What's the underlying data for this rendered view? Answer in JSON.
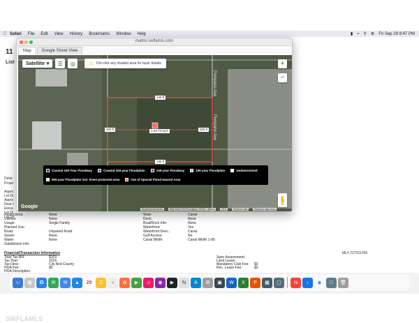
{
  "menubar": {
    "app": "Safari",
    "items": [
      "File",
      "Edit",
      "View",
      "History",
      "Bookmarks",
      "Window",
      "Help"
    ],
    "clock": "Fri Sep 29  8:47 PM"
  },
  "listing": {
    "title": "11",
    "list_label": "List",
    "side_labels": [
      "Detai",
      "Prope",
      "Appro",
      "Lot Di",
      "Appro",
      "Rear I",
      "Eleva",
      "Lot Di",
      "Lot De"
    ],
    "details_left": [
      {
        "k": "Restrictions:",
        "v": "None"
      },
      {
        "k": "Utilities:",
        "v": "None"
      },
      {
        "k": "Usage:",
        "v": "Single Family"
      },
      {
        "k": "Planned Use:",
        "v": ""
      },
      {
        "k": "Road:",
        "v": "Unpaved Road"
      },
      {
        "k": "Sewer:",
        "v": "None"
      },
      {
        "k": "Water:",
        "v": "None"
      },
      {
        "k": "Subdivision Info:",
        "v": ""
      }
    ],
    "details_right": [
      {
        "k": "View:",
        "v": "Canal"
      },
      {
        "k": "Dock:",
        "v": "None"
      },
      {
        "k": "Boat/Dock Info:",
        "v": "None"
      },
      {
        "k": "Waterfront:",
        "v": "Yes"
      },
      {
        "k": "Waterfront Desc.:",
        "v": "Canal"
      },
      {
        "k": "Gulf Access:",
        "v": "No"
      },
      {
        "k": "Canal Width:",
        "v": "Canal Width 1-80"
      }
    ],
    "mls_number": "ML# 217031266",
    "financial_heading": "Financial/Transaction Information",
    "financial_left": [
      {
        "k": "Total Tax Bill:",
        "v": "$169"
      },
      {
        "k": "Tax Year:",
        "v": "2016"
      },
      {
        "k": "Tax Desc:",
        "v": "City And County"
      },
      {
        "k": "HOA Fee:",
        "v": "$0"
      },
      {
        "k": "HOA Description:",
        "v": ""
      }
    ],
    "financial_right": [
      {
        "k": "Spec Assessment:",
        "v": ""
      },
      {
        "k": "Land Lease:",
        "v": ""
      },
      {
        "k": "Mandatory Club Fee:",
        "v": "$0"
      },
      {
        "k": "Rec. Lease Fee:",
        "v": "$0"
      }
    ]
  },
  "popup": {
    "url": "matrix.swflamls.com",
    "tabs": [
      "Map",
      "Google Street View"
    ],
    "map_type": "Satellite",
    "hint": "Ctrl-click any shaded area for layer details.",
    "street_name": "Pompano Ave",
    "lot_label": "1,23.73 sq ft",
    "dims": {
      "top": "140 ft",
      "left": "100 ft",
      "right": "100 ft",
      "bottom": "140 ft"
    },
    "legend": [
      {
        "label": "Coastal 100-Year Floodway",
        "color": "#1a237e"
      },
      {
        "label": "Coastal 100-year Floodplain",
        "color": "#3f51b5"
      },
      {
        "label": "100-year Floodway",
        "color": "#7b1fa2"
      },
      {
        "label": "100-year Floodplain",
        "color": "#b39ddb"
      },
      {
        "label": "Undetermined",
        "color": "#ffffff"
      },
      {
        "label": "500-year Floodplain incl. levee protected area",
        "color": "#fff176"
      },
      {
        "label": "Out of Special Flood Hazard Area",
        "color": "#ff7043"
      }
    ],
    "footer": [
      "Keyboard shortcuts",
      "Map Data ©2023 Imagery ©2023 , Airbus",
      "20 ft",
      "Terms of Use",
      "Report a map error"
    ],
    "google": "Google"
  },
  "dock": {
    "calendar_day": "29",
    "colors": [
      "#3a7bd5",
      "#e5e5e5",
      "#2f80ed",
      "#34a853",
      "#4285f4",
      "#1e88e5",
      "#2ecc71",
      "#e53935",
      "#fbc02d",
      "#8e24aa",
      "#ff7043",
      "#43a047",
      "#1976d2",
      "#212121",
      "#0288d1",
      "#9e9e9e",
      "#5e35b1",
      "#00897b",
      "#37474f",
      "#1565c0",
      "#2e7d32",
      "#e65100",
      "#455a64"
    ]
  },
  "watermark": "SWFLAMLS"
}
